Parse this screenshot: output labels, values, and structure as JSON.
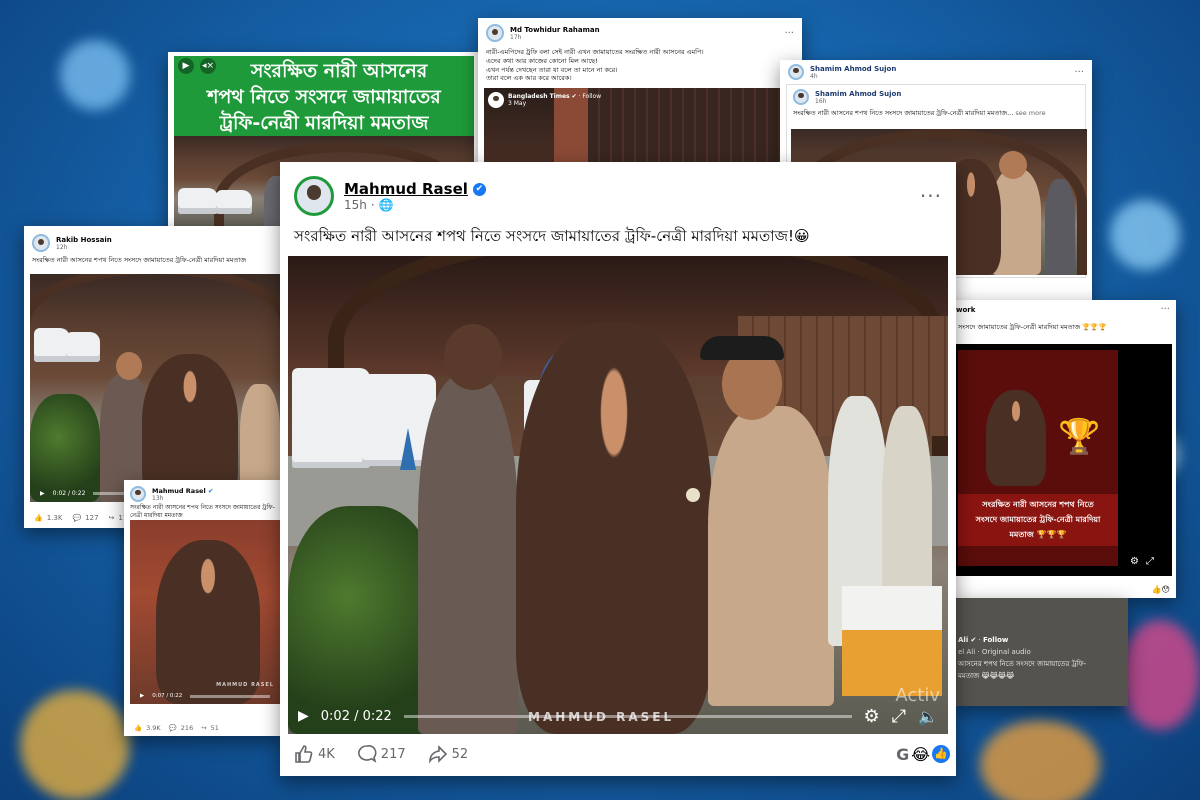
{
  "cards": {
    "rakib": {
      "name": "Rakib Hossain",
      "time": "12h",
      "caption": "সংরক্ষিত নারী আসনের শপথ নিতে সংসদে জামায়াতের ট্রফি-নেত্রী মারদিয়া মমতাজ",
      "video_time": "0:02 / 0:22",
      "likes": "1.3K",
      "comments": "127",
      "shares": "11"
    },
    "mahmud_small": {
      "name": "Mahmud Rasel",
      "time": "13h",
      "caption": "সংরক্ষিত নারী আসনের শপথ নিতে সংসদে জামায়াতের ট্রফি-নেত্রী মারদিয়া মমতাজ",
      "video_time": "0:07 / 0:22",
      "likes": "3.9K",
      "comments": "216",
      "shares": "51",
      "watermark": "MAHMUD RASEL"
    },
    "tv": {
      "headline_line1": "সংরক্ষিত নারী আসনের",
      "headline_line2": "শপথ নিতে সংসদে জামায়াতের",
      "headline_line3": "ট্রফি-নেত্রী মারদিয়া মমতাজ"
    },
    "towhidur": {
      "name": "Md Towhidur Rahaman",
      "time": "17h",
      "line1": "নারী-এমপিদের ট্রফি বলা সেই নারী এখন জামায়াতের সংরক্ষিত নারী আসনের এমপি।",
      "line2": "এদের কথা আর কাজের কোনো মিল আছে!",
      "line3": "এখন পর্যন্ত দেখছেন তারা যা বলে তা মানে না করে।",
      "line4": "তারা বলে এক আর করে আরেক।",
      "shared_page": "Bangladesh Times",
      "shared_follow": "Follow",
      "shared_date": "3 May"
    },
    "shamim": {
      "name": "Shamim Ahmod Sujon",
      "time": "4h",
      "inner_name": "Shamim Ahmod Sujon",
      "inner_time": "16h",
      "caption": "সংরক্ষিত নারী আসনের শপথ নিতে সংসদে জামায়াতের ট্রফি-নেত্রী মারদিয়া মমতাজ...",
      "see_more": "see more"
    },
    "network": {
      "name": "work",
      "caption": "সংসদে জামায়াতের ট্রফি-নেত্রী মারদিয়া মমতাজ 🏆🏆🏆",
      "banner_line1": "সংরক্ষিত নারী আসনের শপথ নিতে",
      "banner_line2": "সংসদে জামায়াতের ট্রফি-নেত্রী মারদিয়া",
      "banner_line3": "মমতাজ 🏆🏆🏆"
    },
    "ali": {
      "name": "Ali",
      "follow": "Follow",
      "sub": "el Ali · Original audio",
      "caption_line1": "আসনের শপথ নিতে সংসদে জামায়াতের ট্রফি-",
      "caption_line2": "মমতাজ 😹😹😹😹"
    },
    "main": {
      "name": "Mahmud Rasel",
      "time": "15h",
      "caption": "সংরক্ষিত নারী আসনের শপথ নিতে সংসদে জামায়াতের ট্রফি-নেত্রী মারদিয়া মমতাজ!😀",
      "video_time": "0:02 / 0:22",
      "watermark": "MAHMUD RASEL",
      "likes": "4K",
      "comments": "217",
      "shares": "52",
      "overlay_text": "Activ"
    }
  },
  "colors": {
    "fb_blue": "#1877f2",
    "news_green": "#1f9a3a",
    "banner_red": "#8a1410"
  }
}
